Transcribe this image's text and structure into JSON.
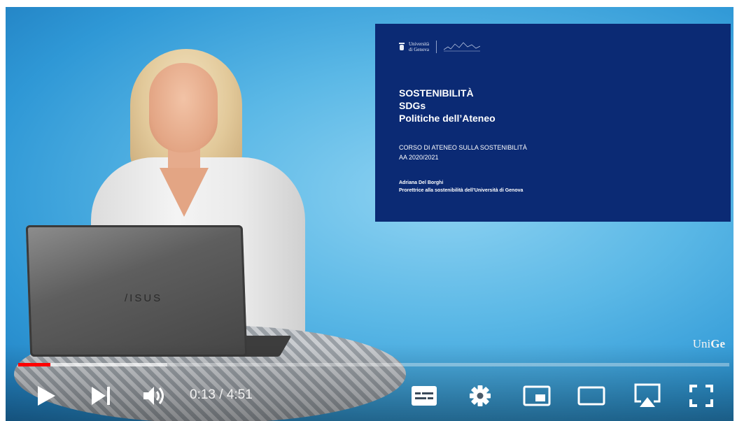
{
  "slide": {
    "university_line1": "Università",
    "university_line2": "di Genova",
    "titles": [
      "SOSTENIBILITÀ",
      "SDGs",
      "Politiche dell’Ateneo"
    ],
    "course_line1": "CORSO DI ATENEO SULLA SOSTENIBILITÀ",
    "course_line2": "AA 2020/2021",
    "author_name": "Adriana Del Borghi",
    "author_role": "Prorettrice alla sostenibilità dell’Università di Genova"
  },
  "laptop_brand": "/ISUS",
  "watermark": {
    "part1": "Uni",
    "part2": "Ge"
  },
  "player": {
    "current_time": "0:13",
    "duration": "4:51",
    "time_separator": " / ",
    "progress_played_fraction": 0.045,
    "progress_buffered_fraction": 0.21,
    "accent_color": "#ff0000",
    "controls": [
      "play-icon",
      "next-icon",
      "volume-icon",
      "subtitles-icon",
      "settings-icon",
      "miniplayer-icon",
      "theater-mode-icon",
      "airplay-icon",
      "fullscreen-icon"
    ]
  }
}
